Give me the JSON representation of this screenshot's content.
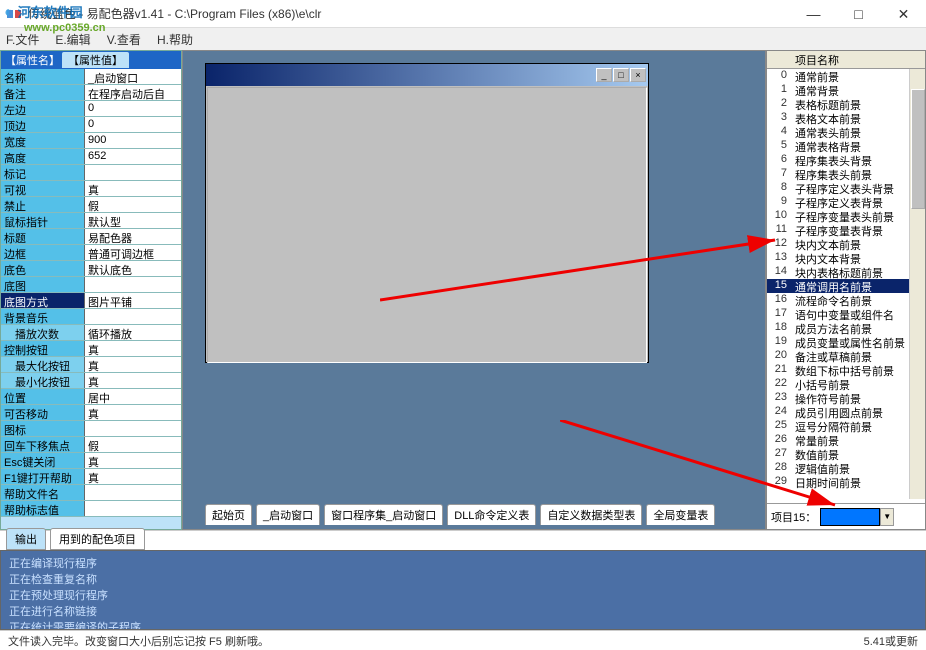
{
  "window": {
    "title": "传统蓝色 - 易配色器v1.41 - C:\\Program Files (x86)\\e\\clr",
    "min": "—",
    "max": "□",
    "close": "✕"
  },
  "watermark": {
    "brand": "河东软件园",
    "url": "www.pc0359.cn"
  },
  "menu": {
    "file": "F.文件",
    "edit": "E.编辑",
    "view": "V.查看",
    "help": "H.帮助"
  },
  "propPanel": {
    "header_left": "【属性名】",
    "header_tab": "【属性值】",
    "rows": [
      {
        "k": "名称",
        "v": "_启动窗口"
      },
      {
        "k": "备注",
        "v": "在程序启动后自"
      },
      {
        "k": "左边",
        "v": "0"
      },
      {
        "k": "顶边",
        "v": "0"
      },
      {
        "k": "宽度",
        "v": "900"
      },
      {
        "k": "高度",
        "v": "652"
      },
      {
        "k": "标记",
        "v": ""
      },
      {
        "k": "可视",
        "v": "真"
      },
      {
        "k": "禁止",
        "v": "假"
      },
      {
        "k": "鼠标指针",
        "v": "默认型"
      },
      {
        "k": "标题",
        "v": "易配色器"
      },
      {
        "k": "边框",
        "v": "普通可调边框"
      },
      {
        "k": "底色",
        "v": "默认底色"
      },
      {
        "k": "底图",
        "v": ""
      },
      {
        "k": "底图方式",
        "v": "图片平铺",
        "sel": true
      },
      {
        "k": "背景音乐",
        "v": ""
      },
      {
        "k": "播放次数",
        "v": "循环播放",
        "indent": true
      },
      {
        "k": "控制按钮",
        "v": "真"
      },
      {
        "k": "最大化按钮",
        "v": "真",
        "indent": true
      },
      {
        "k": "最小化按钮",
        "v": "真",
        "indent": true
      },
      {
        "k": "位置",
        "v": "居中"
      },
      {
        "k": "可否移动",
        "v": "真"
      },
      {
        "k": "图标",
        "v": ""
      },
      {
        "k": "回车下移焦点",
        "v": "假"
      },
      {
        "k": "Esc键关闭",
        "v": "真"
      },
      {
        "k": "F1键打开帮助",
        "v": "真"
      },
      {
        "k": "帮助文件名",
        "v": ""
      },
      {
        "k": "帮助标志值",
        "v": ""
      }
    ]
  },
  "centerTabs": [
    "起始页",
    "_启动窗口",
    "窗口程序集_启动窗口",
    "DLL命令定义表",
    "自定义数据类型表",
    "全局变量表"
  ],
  "rightPanel": {
    "hdr_num": "",
    "hdr_name": "项目名称",
    "items": [
      "通常前景",
      "通常背景",
      "表格标题前景",
      "表格文本前景",
      "通常表头前景",
      "通常表格背景",
      "程序集表头背景",
      "程序集表头前景",
      "子程序定义表头背景",
      "子程序定义表背景",
      "子程序变量表头前景",
      "子程序变量表背景",
      "块内文本前景",
      "块内文本背景",
      "块内表格标题前景",
      "通常调用名前景",
      "流程命令名前景",
      "语句中变量或组件名",
      "成员方法名前景",
      "成员变量或属性名前景",
      "备注或草稿前景",
      "数组下标中括号前景",
      "小括号前景",
      "操作符号前景",
      "成员引用圆点前景",
      "逗号分隔符前景",
      "常量前景",
      "数值前景",
      "逻辑值前景",
      "日期时间前景"
    ],
    "selected_index": 15,
    "footer_label": "项目15：",
    "swatch_color": "#0076ff"
  },
  "outputTabs": {
    "t1": "输出",
    "t2": "用到的配色项目"
  },
  "outputLines": "正在编译现行程序\n正在检查重复名称\n正在预处理现行程序\n正在进行名称链接\n正在统计需要编译的子程序\n正在编译...",
  "status": {
    "left": "文件读入完毕。改变窗口大小后别忘记按 F5 刷新哦。",
    "right": "5.41或更新"
  }
}
